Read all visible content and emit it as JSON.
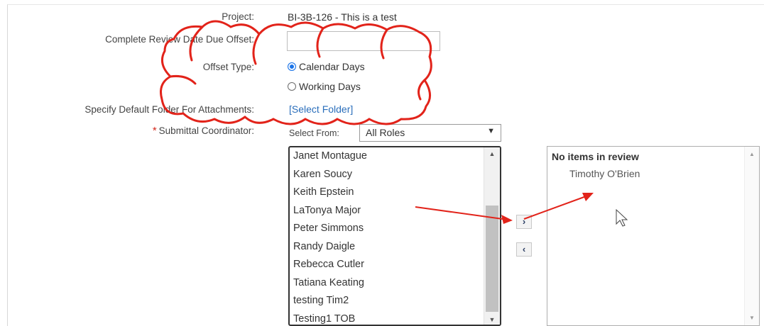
{
  "form": {
    "project_label": "Project:",
    "project_value": "BI-3B-126 - This is a test",
    "offset_label": "Complete Review Date Due Offset:",
    "offset_value": "",
    "offset_type_label": "Offset Type:",
    "offset_type_options": [
      "Calendar Days",
      "Working Days"
    ],
    "offset_type_selected": "Calendar Days",
    "folder_label": "Specify Default Folder For Attachments:",
    "folder_link": "[Select Folder]",
    "coordinator_required_mark": "*",
    "coordinator_label": "Submittal Coordinator:",
    "select_from_label": "Select From:",
    "select_from_value": "All Roles"
  },
  "available_list": {
    "items": [
      "Janet Montague",
      "Karen Soucy",
      "Keith Epstein",
      "LaTonya Major",
      "Peter Simmons",
      "Randy Daigle",
      "Rebecca Cutler",
      "Tatiana Keating",
      "testing Tim2",
      "Testing1 TOB"
    ]
  },
  "move_buttons": {
    "add": "›",
    "remove": "‹"
  },
  "review_list": {
    "header": "No items in review",
    "items": [
      "Timothy O'Brien"
    ]
  },
  "annotation": {
    "color": "#e2231a"
  }
}
